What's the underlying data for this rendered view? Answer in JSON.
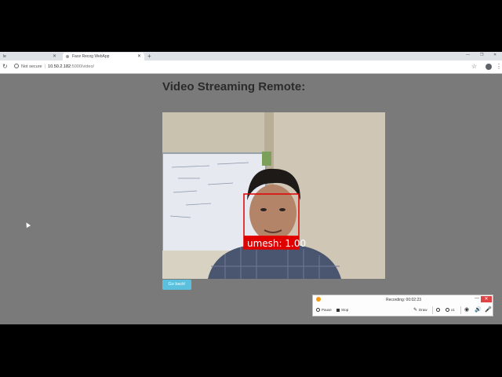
{
  "browser": {
    "tabs": [
      {
        "label": "le",
        "active": false
      },
      {
        "label": "Face Recog WebApp",
        "active": true
      }
    ],
    "new_tab": "+",
    "security_label": "Not secure",
    "url_host": "10.50.2.182",
    "url_path": ":5000/video/"
  },
  "page": {
    "title": "Video Streaming Remote:",
    "detection_label": "umesh: 1.00",
    "back_button": "Go back!"
  },
  "recorder": {
    "status": "Recording: 00:02:23",
    "pause_label": "Pause",
    "stop_label": "Stop",
    "draw_label": "Draw",
    "zoom_level": "x1"
  },
  "colors": {
    "page_background": "#7a7a7a",
    "button": "#5bc0de",
    "detection_box": "#e00000"
  }
}
